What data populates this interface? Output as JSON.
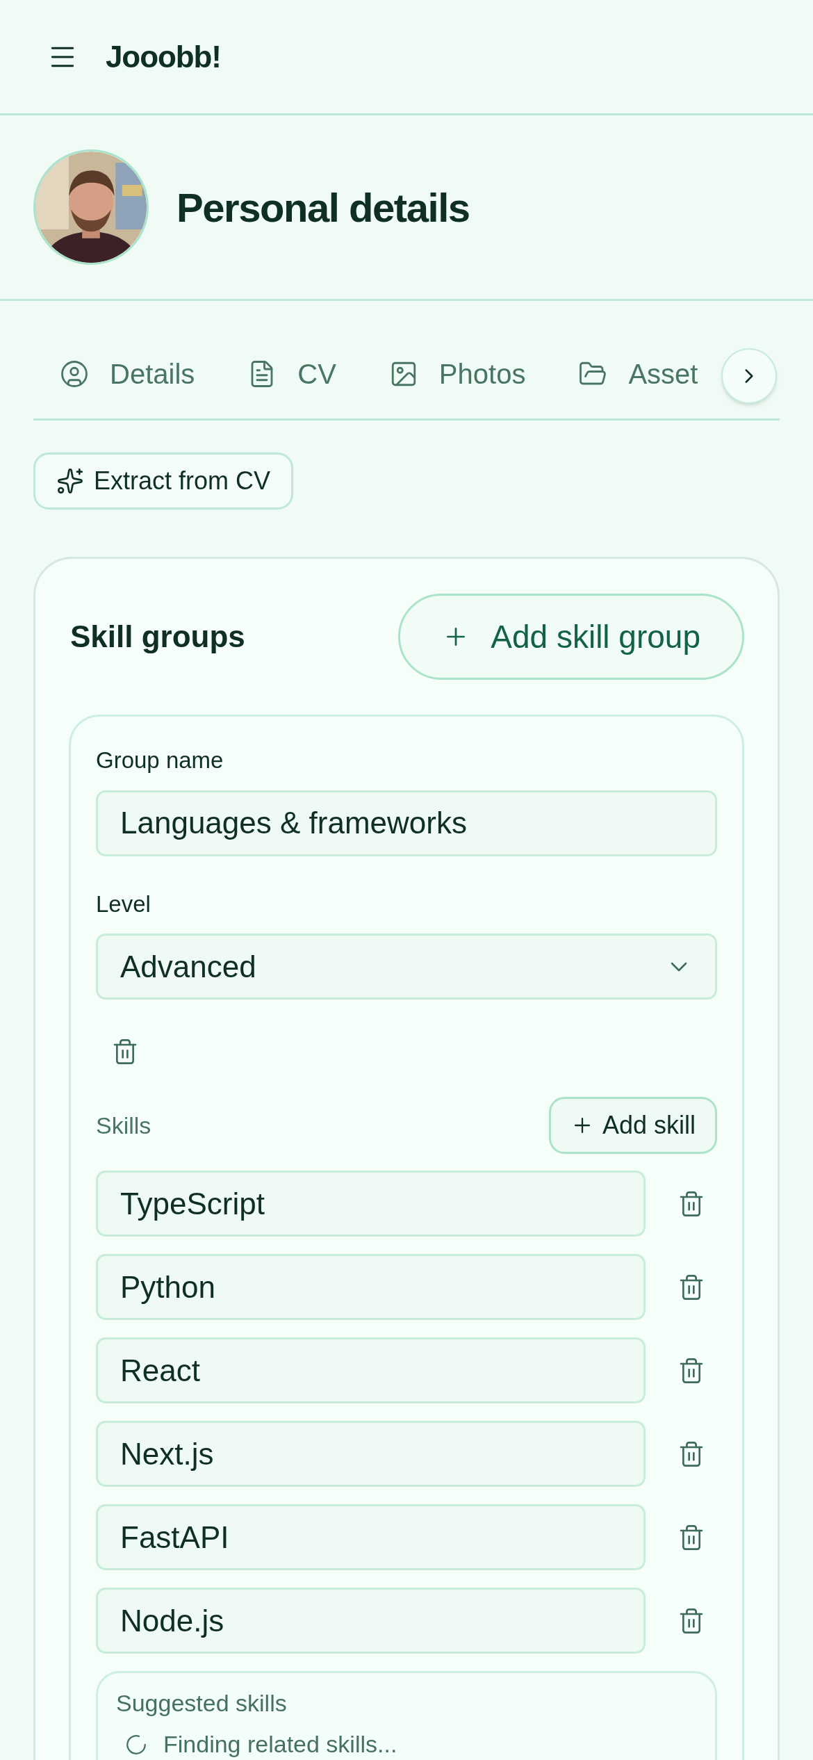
{
  "app": {
    "title": "Jooobb!"
  },
  "profile": {
    "title": "Personal details"
  },
  "tabs": [
    {
      "label": "Details",
      "selected": false
    },
    {
      "label": "CV",
      "selected": false
    },
    {
      "label": "Photos",
      "selected": false
    },
    {
      "label": "Asset",
      "selected": false
    }
  ],
  "extract_button": "Extract from CV",
  "skill_groups": {
    "title": "Skill groups",
    "add_button": "Add skill group",
    "group": {
      "name_label": "Group name",
      "name_value": "Languages & frameworks",
      "level_label": "Level",
      "level_value": "Advanced",
      "skills_label": "Skills",
      "add_skill_button": "Add skill",
      "skills": [
        "TypeScript",
        "Python",
        "React",
        "Next.js",
        "FastAPI",
        "Node.js"
      ],
      "suggested": {
        "title": "Suggested skills",
        "status": "Finding related skills..."
      }
    }
  }
}
